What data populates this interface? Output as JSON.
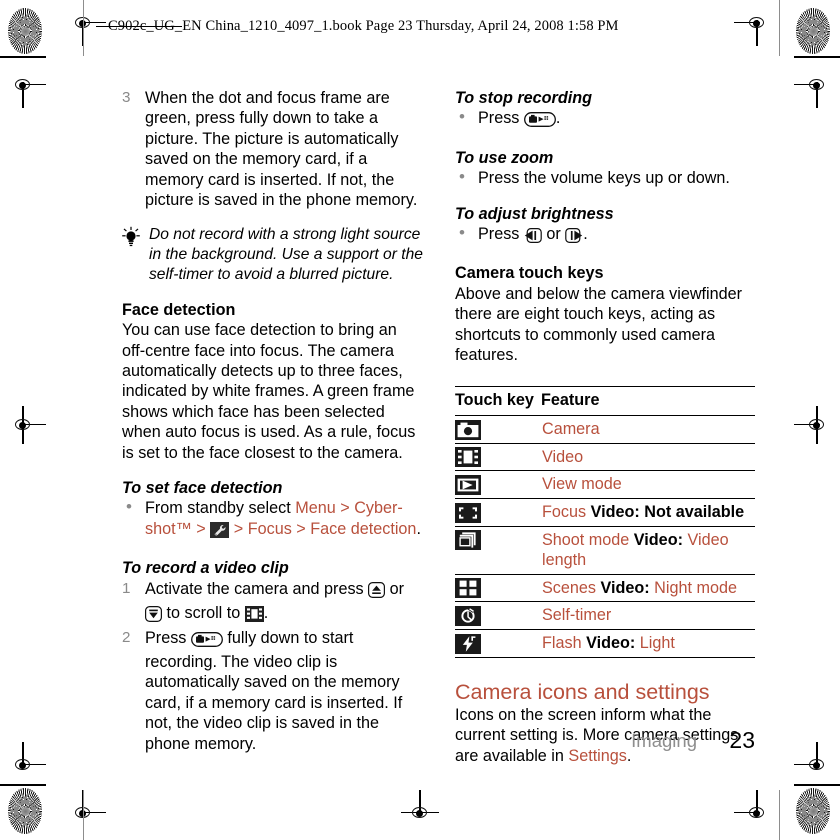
{
  "header": {
    "slug": "C902c_UG_EN China_1210_4097_1.book   Page 23   Thursday, April 24, 2008   1:58 PM"
  },
  "accent_color": "#b8503c",
  "left_column": {
    "step3": {
      "marker": "3",
      "text": "When the dot and focus frame are green, press fully down to take a picture. The picture is automatically saved on the memory card, if a memory card is inserted. If not, the picture is saved in the phone memory."
    },
    "tip": {
      "icon": "lightbulb-icon",
      "text": "Do not record with a strong light source in the background. Use a support or the self-timer to avoid a blurred picture."
    },
    "face_detection": {
      "heading": "Face detection",
      "body": "You can use face detection to bring an off-centre face into focus. The camera automatically detects up to three faces, indicated by white frames. A green frame shows which face has been selected when auto focus is used. As a rule, focus is set to the face closest to the camera."
    },
    "to_set_face_detection": {
      "heading": "To set face detection",
      "marker": "•",
      "prefix": "From standby select ",
      "menu": "Menu",
      "sep1": " > ",
      "cybershot": "Cyber-shot™",
      "sep2": " > ",
      "settings_icon": "wrench-settings-icon",
      "sep3": " > ",
      "focus": "Focus",
      "sep4": " > ",
      "face_detection": "Face detection",
      "period": "."
    },
    "to_record_video": {
      "heading": "To record a video clip",
      "steps": [
        {
          "marker": "1",
          "part1": "Activate the camera and press ",
          "icon1": "nav-up-key-icon",
          "part2": " or ",
          "icon2": "nav-down-key-icon",
          "part3": " to scroll to ",
          "icon3": "video-mode-icon",
          "part4": "."
        },
        {
          "marker": "2",
          "part1": "Press ",
          "icon1": "camera-shutter-key-icon",
          "part2": " fully down to start recording. The video clip is automatically saved on the memory card, if a memory card is inserted. If not, the video clip is saved in the phone memory."
        }
      ]
    }
  },
  "right_column": {
    "to_stop_recording": {
      "heading": "To stop recording",
      "marker": "•",
      "prefix": "Press ",
      "icon": "camera-shutter-key-icon",
      "suffix": "."
    },
    "to_use_zoom": {
      "heading": "To use zoom",
      "marker": "•",
      "text": "Press the volume keys up or down."
    },
    "to_adjust_brightness": {
      "heading": "To adjust brightness",
      "marker": "•",
      "prefix": "Press ",
      "icon_left": "nav-left-key-icon",
      "middle": " or ",
      "icon_right": "nav-right-key-icon",
      "suffix": "."
    },
    "camera_touch_keys": {
      "heading": "Camera touch keys",
      "body": "Above and below the camera viewfinder there are eight touch keys, acting as shortcuts to commonly used camera features."
    },
    "table": {
      "columns": [
        "Touch key",
        "Feature"
      ],
      "rows": [
        {
          "icon": "camera-icon",
          "parts": [
            {
              "t": "Camera",
              "s": "accent"
            }
          ]
        },
        {
          "icon": "video-icon",
          "parts": [
            {
              "t": "Video",
              "s": "accent"
            }
          ]
        },
        {
          "icon": "view-mode-icon",
          "parts": [
            {
              "t": "View mode",
              "s": "accent"
            }
          ]
        },
        {
          "icon": "focus-icon",
          "parts": [
            {
              "t": "Focus ",
              "s": "accent"
            },
            {
              "t": "Video:",
              "s": "bold"
            },
            {
              "t": " Not available",
              "s": "bold"
            }
          ]
        },
        {
          "icon": "shoot-mode-icon",
          "parts": [
            {
              "t": "Shoot mode ",
              "s": "accent"
            },
            {
              "t": "Video:",
              "s": "bold"
            },
            {
              "t": " ",
              "s": "plain"
            },
            {
              "t": "Video length",
              "s": "accent"
            }
          ]
        },
        {
          "icon": "scenes-icon",
          "parts": [
            {
              "t": "Scenes ",
              "s": "accent"
            },
            {
              "t": "Video:",
              "s": "bold"
            },
            {
              "t": " ",
              "s": "plain"
            },
            {
              "t": "Night mode",
              "s": "accent"
            }
          ]
        },
        {
          "icon": "self-timer-icon",
          "parts": [
            {
              "t": "Self-timer",
              "s": "accent"
            }
          ]
        },
        {
          "icon": "flash-icon",
          "parts": [
            {
              "t": "Flash ",
              "s": "accent"
            },
            {
              "t": "Video:",
              "s": "bold"
            },
            {
              "t": " ",
              "s": "plain"
            },
            {
              "t": "Light",
              "s": "accent"
            }
          ]
        }
      ]
    },
    "camera_icons_settings": {
      "heading": "Camera icons and settings",
      "prefix": "Icons on the screen inform what the current setting is. More camera settings are available in ",
      "settings": "Settings",
      "suffix": "."
    }
  },
  "footer": {
    "chapter": "Imaging",
    "page_number": "23"
  }
}
